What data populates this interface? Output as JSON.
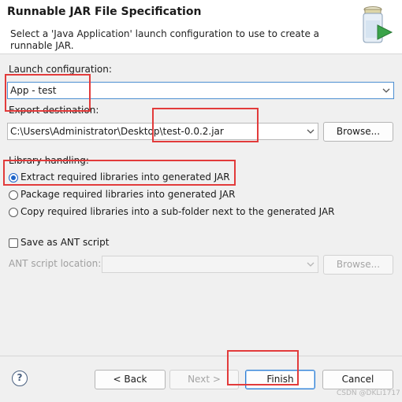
{
  "header": {
    "title": "Runnable JAR File Specification",
    "description": "Select a 'Java Application' launch configuration to use to create a runnable JAR.",
    "icon": "jar-wizard-icon"
  },
  "launch": {
    "label": "Launch configuration:",
    "value": "App - test"
  },
  "export": {
    "label": "Export destination:",
    "value": "C:\\Users\\Administrator\\Desktop\\test-0.0.2.jar",
    "browse": "Browse..."
  },
  "library": {
    "label": "Library handling:",
    "options": [
      {
        "label": "Extract required libraries into generated JAR",
        "checked": true
      },
      {
        "label": "Package required libraries into generated JAR",
        "checked": false
      },
      {
        "label": "Copy required libraries into a sub-folder next to the generated JAR",
        "checked": false
      }
    ]
  },
  "ant": {
    "save_label": "Save as ANT script",
    "save_checked": false,
    "location_label": "ANT script location:",
    "location_value": "",
    "browse": "Browse..."
  },
  "footer": {
    "back": "< Back",
    "next": "Next >",
    "finish": "Finish",
    "cancel": "Cancel",
    "help_symbol": "?"
  },
  "watermark": "CSDN @DKLi1717",
  "colors": {
    "highlight_box": "#e23b3b",
    "radio_selected": "#1e64c8",
    "default_button_border": "#2f7fd4"
  }
}
